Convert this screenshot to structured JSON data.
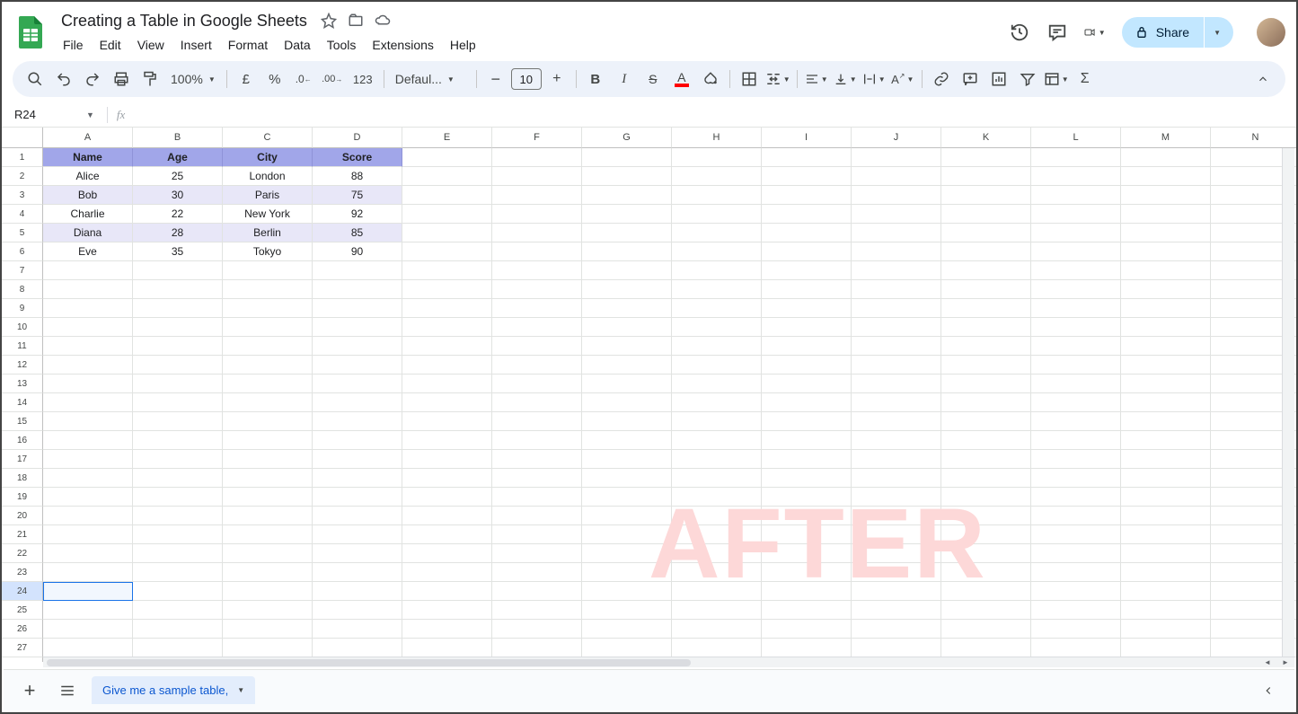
{
  "doc_title": "Creating a Table in Google Sheets",
  "menu": {
    "file": "File",
    "edit": "Edit",
    "view": "View",
    "insert": "Insert",
    "format": "Format",
    "data": "Data",
    "tools": "Tools",
    "extensions": "Extensions",
    "help": "Help"
  },
  "share_label": "Share",
  "toolbar": {
    "zoom": "100%",
    "font": "Defaul...",
    "font_size": "10",
    "currency": "£",
    "percent": "%",
    "dec_dec": ".0",
    "dec_inc": ".00",
    "num_fmt": "123"
  },
  "name_box": "R24",
  "columns": [
    "A",
    "B",
    "C",
    "D",
    "E",
    "F",
    "G",
    "H",
    "I",
    "J",
    "K",
    "L",
    "M",
    "N"
  ],
  "row_count": 28,
  "active_row": 24,
  "active_col": 1,
  "table": {
    "headers": [
      "Name",
      "Age",
      "City",
      "Score"
    ],
    "rows": [
      [
        "Alice",
        "25",
        "London",
        "88"
      ],
      [
        "Bob",
        "30",
        "Paris",
        "75"
      ],
      [
        "Charlie",
        "22",
        "New York",
        "92"
      ],
      [
        "Diana",
        "28",
        "Berlin",
        "85"
      ],
      [
        "Eve",
        "35",
        "Tokyo",
        "90"
      ]
    ]
  },
  "watermark": "AFTER",
  "sheet_tab": "Give me a sample table,"
}
